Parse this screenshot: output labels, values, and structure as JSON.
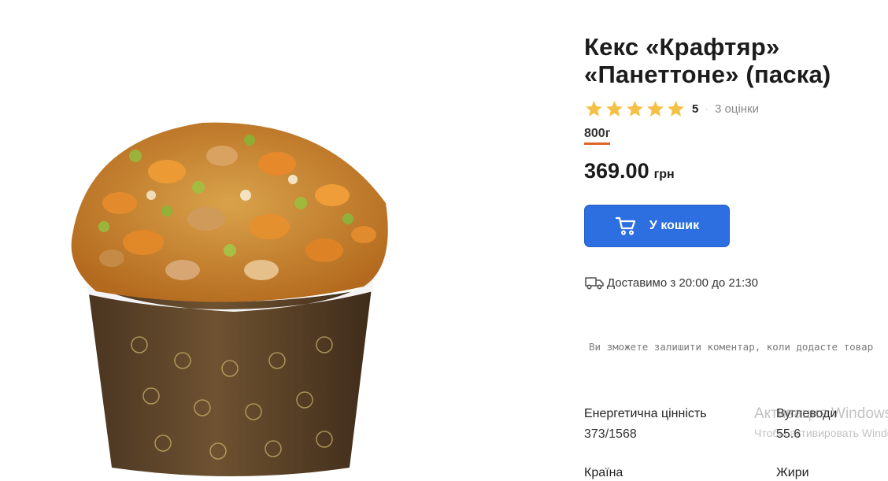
{
  "product": {
    "title": "Кекс «Крафтяр» «Панеттоне» (паска)",
    "rating": {
      "stars": 5,
      "value": "5",
      "separator": "·",
      "count_text": "3 оцінки"
    },
    "weight": "800г",
    "price": {
      "value": "369.00",
      "currency": "грн"
    },
    "cart_button_label": "У кошик",
    "delivery_text": "Доставимо з 20:00 до 21:30",
    "comment_note": "Ви зможете залишити коментар, коли додасте товар"
  },
  "specs": [
    {
      "label": "Енергетична цінність",
      "value": "373/1568"
    },
    {
      "label": "Вуглеводи",
      "value": "55.6"
    },
    {
      "label": "Країна",
      "value": ""
    },
    {
      "label": "Жири",
      "value": ""
    }
  ],
  "watermark": {
    "line1": "Активация Windows",
    "line2": "Чтобы активировать Windows"
  },
  "colors": {
    "accent": "#2d6fe0",
    "star": "#f4c146",
    "weight_underline": "#e0642a"
  },
  "icons": {
    "cart": "cart-icon",
    "delivery": "truck-icon",
    "star": "star-icon"
  }
}
